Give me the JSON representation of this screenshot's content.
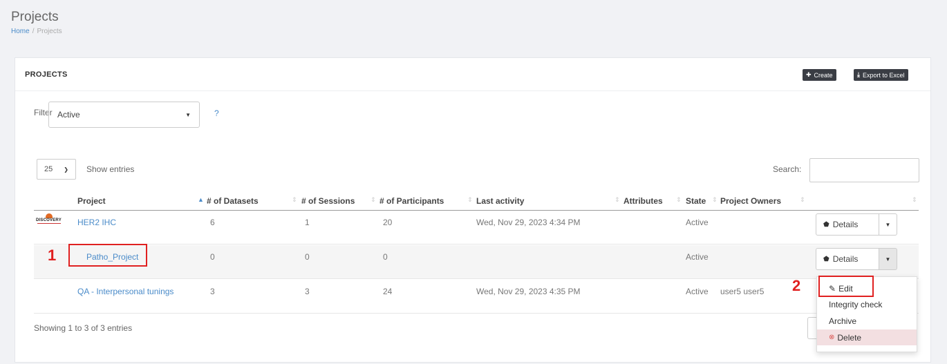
{
  "header": {
    "title": "Projects",
    "breadcrumb": {
      "home": "Home",
      "separator": "/",
      "current": "Projects"
    }
  },
  "panel": {
    "title": "PROJECTS",
    "create_label": "Create",
    "export_label": "Export to Excel"
  },
  "filter": {
    "label": "Filter",
    "value": "Active",
    "help": "?"
  },
  "table_controls": {
    "length_value": "25",
    "length_label": "Show entries",
    "search_label": "Search:",
    "search_value": ""
  },
  "columns": [
    "Project",
    "# of Datasets",
    "# of Sessions",
    "# of Participants",
    "Last activity",
    "Attributes",
    "State",
    "Project Owners"
  ],
  "rows": [
    {
      "logo": "DISCOVERY",
      "project": "HER2 IHC",
      "datasets": "6",
      "sessions": "1",
      "participants": "20",
      "last_activity": "Wed, Nov 29, 2023 4:34 PM",
      "attributes": "",
      "state": "Active",
      "owners": ""
    },
    {
      "logo": "",
      "project": "Patho_Project",
      "datasets": "0",
      "sessions": "0",
      "participants": "0",
      "last_activity": "",
      "attributes": "",
      "state": "Active",
      "owners": ""
    },
    {
      "logo": "",
      "project": "QA - Interpersonal tunings",
      "datasets": "3",
      "sessions": "3",
      "participants": "24",
      "last_activity": "Wed, Nov 29, 2023 4:35 PM",
      "attributes": "",
      "state": "Active",
      "owners": "user5 user5"
    }
  ],
  "actions": {
    "details_label": "Details",
    "menu": {
      "edit": "Edit",
      "integrity": "Integrity check",
      "archive": "Archive",
      "delete": "Delete"
    }
  },
  "info": "Showing 1 to 3 of 3 entries",
  "annotations": {
    "marker1": "1",
    "marker2": "2",
    "color": "#e02020"
  },
  "colors": {
    "link": "#4a8bc9",
    "dark_button": "#3a3d44",
    "delete_bg": "#f3dfe1"
  }
}
